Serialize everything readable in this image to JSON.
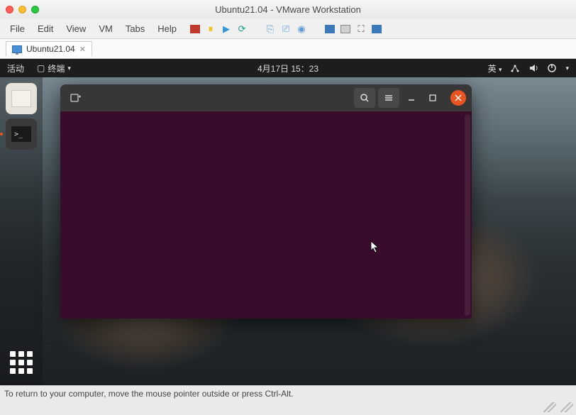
{
  "host": {
    "title": "Ubuntu21.04 - VMware Workstation",
    "menu": [
      "File",
      "Edit",
      "View",
      "VM",
      "Tabs",
      "Help"
    ],
    "tab_label": "Ubuntu21.04",
    "status": "To return to your computer, move the mouse pointer outside or press Ctrl-Alt."
  },
  "ubuntu": {
    "activities": "活动",
    "app_menu": "终端",
    "datetime": "4月17日  15：23",
    "input_method": "英"
  },
  "dock": {
    "files": "files",
    "terminal": "terminal",
    "terminal_prompt": ">_",
    "apps": "show-applications"
  },
  "terminal": {
    "new_tab": "new-tab",
    "search": "search",
    "menu": "menu",
    "minimize": "minimize",
    "maximize": "maximize",
    "close": "close"
  },
  "icons": {
    "toolbar_colors": {
      "record": "#c0392b",
      "pause": "#f1c40f",
      "play": "#3498db",
      "snapshot": "#16a085"
    }
  }
}
